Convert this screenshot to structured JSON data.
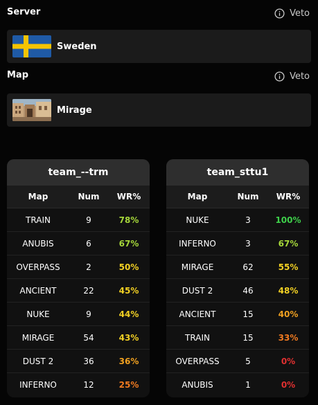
{
  "server": {
    "title": "Server",
    "veto_label": "Veto",
    "selected": "Sweden"
  },
  "map": {
    "title": "Map",
    "veto_label": "Veto",
    "selected": "Mirage"
  },
  "table_headers": {
    "map": "Map",
    "num": "Num",
    "wr": "WR%"
  },
  "colors": {
    "wr_green": "#3ecf4a",
    "wr_lightgreen": "#a5d63a",
    "wr_yellow": "#f2d023",
    "wr_orange": "#f0a020",
    "wr_darkorange": "#f07a20",
    "wr_red": "#e03030"
  },
  "teams": [
    {
      "name": "team_--trm",
      "rows": [
        {
          "map": "TRAIN",
          "num": "9",
          "wr": "78%",
          "tone": "wr_lightgreen"
        },
        {
          "map": "ANUBIS",
          "num": "6",
          "wr": "67%",
          "tone": "wr_lightgreen"
        },
        {
          "map": "OVERPASS",
          "num": "2",
          "wr": "50%",
          "tone": "wr_yellow"
        },
        {
          "map": "ANCIENT",
          "num": "22",
          "wr": "45%",
          "tone": "wr_yellow"
        },
        {
          "map": "NUKE",
          "num": "9",
          "wr": "44%",
          "tone": "wr_yellow"
        },
        {
          "map": "MIRAGE",
          "num": "54",
          "wr": "43%",
          "tone": "wr_yellow"
        },
        {
          "map": "DUST 2",
          "num": "36",
          "wr": "36%",
          "tone": "wr_orange"
        },
        {
          "map": "INFERNO",
          "num": "12",
          "wr": "25%",
          "tone": "wr_darkorange"
        }
      ]
    },
    {
      "name": "team_sttu1",
      "rows": [
        {
          "map": "NUKE",
          "num": "3",
          "wr": "100%",
          "tone": "wr_green"
        },
        {
          "map": "INFERNO",
          "num": "3",
          "wr": "67%",
          "tone": "wr_lightgreen"
        },
        {
          "map": "MIRAGE",
          "num": "62",
          "wr": "55%",
          "tone": "wr_yellow"
        },
        {
          "map": "DUST 2",
          "num": "46",
          "wr": "48%",
          "tone": "wr_yellow"
        },
        {
          "map": "ANCIENT",
          "num": "15",
          "wr": "40%",
          "tone": "wr_orange"
        },
        {
          "map": "TRAIN",
          "num": "15",
          "wr": "33%",
          "tone": "wr_darkorange"
        },
        {
          "map": "OVERPASS",
          "num": "5",
          "wr": "0%",
          "tone": "wr_red"
        },
        {
          "map": "ANUBIS",
          "num": "1",
          "wr": "0%",
          "tone": "wr_red"
        }
      ]
    }
  ]
}
